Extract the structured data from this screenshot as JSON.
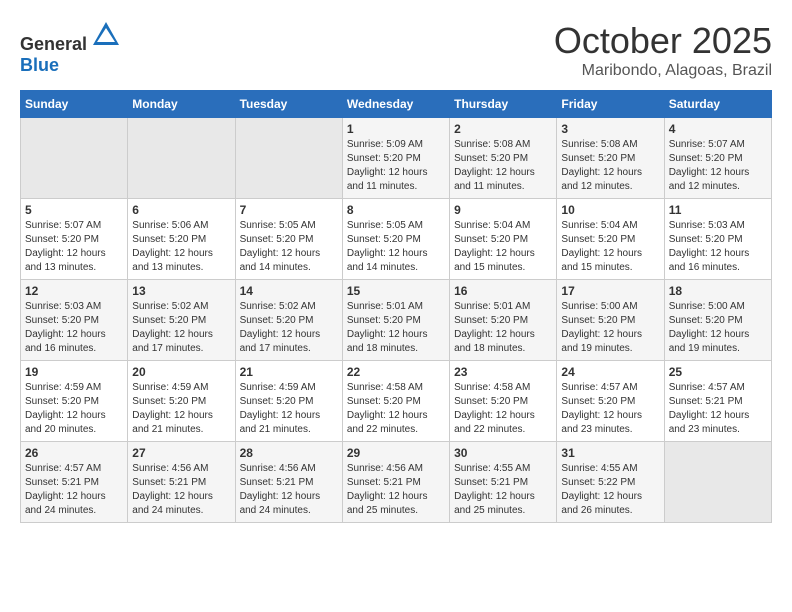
{
  "header": {
    "logo_general": "General",
    "logo_blue": "Blue",
    "month_title": "October 2025",
    "location": "Maribondo, Alagoas, Brazil"
  },
  "weekdays": [
    "Sunday",
    "Monday",
    "Tuesday",
    "Wednesday",
    "Thursday",
    "Friday",
    "Saturday"
  ],
  "weeks": [
    [
      {
        "day": "",
        "info": ""
      },
      {
        "day": "",
        "info": ""
      },
      {
        "day": "",
        "info": ""
      },
      {
        "day": "1",
        "info": "Sunrise: 5:09 AM\nSunset: 5:20 PM\nDaylight: 12 hours\nand 11 minutes."
      },
      {
        "day": "2",
        "info": "Sunrise: 5:08 AM\nSunset: 5:20 PM\nDaylight: 12 hours\nand 11 minutes."
      },
      {
        "day": "3",
        "info": "Sunrise: 5:08 AM\nSunset: 5:20 PM\nDaylight: 12 hours\nand 12 minutes."
      },
      {
        "day": "4",
        "info": "Sunrise: 5:07 AM\nSunset: 5:20 PM\nDaylight: 12 hours\nand 12 minutes."
      }
    ],
    [
      {
        "day": "5",
        "info": "Sunrise: 5:07 AM\nSunset: 5:20 PM\nDaylight: 12 hours\nand 13 minutes."
      },
      {
        "day": "6",
        "info": "Sunrise: 5:06 AM\nSunset: 5:20 PM\nDaylight: 12 hours\nand 13 minutes."
      },
      {
        "day": "7",
        "info": "Sunrise: 5:05 AM\nSunset: 5:20 PM\nDaylight: 12 hours\nand 14 minutes."
      },
      {
        "day": "8",
        "info": "Sunrise: 5:05 AM\nSunset: 5:20 PM\nDaylight: 12 hours\nand 14 minutes."
      },
      {
        "day": "9",
        "info": "Sunrise: 5:04 AM\nSunset: 5:20 PM\nDaylight: 12 hours\nand 15 minutes."
      },
      {
        "day": "10",
        "info": "Sunrise: 5:04 AM\nSunset: 5:20 PM\nDaylight: 12 hours\nand 15 minutes."
      },
      {
        "day": "11",
        "info": "Sunrise: 5:03 AM\nSunset: 5:20 PM\nDaylight: 12 hours\nand 16 minutes."
      }
    ],
    [
      {
        "day": "12",
        "info": "Sunrise: 5:03 AM\nSunset: 5:20 PM\nDaylight: 12 hours\nand 16 minutes."
      },
      {
        "day": "13",
        "info": "Sunrise: 5:02 AM\nSunset: 5:20 PM\nDaylight: 12 hours\nand 17 minutes."
      },
      {
        "day": "14",
        "info": "Sunrise: 5:02 AM\nSunset: 5:20 PM\nDaylight: 12 hours\nand 17 minutes."
      },
      {
        "day": "15",
        "info": "Sunrise: 5:01 AM\nSunset: 5:20 PM\nDaylight: 12 hours\nand 18 minutes."
      },
      {
        "day": "16",
        "info": "Sunrise: 5:01 AM\nSunset: 5:20 PM\nDaylight: 12 hours\nand 18 minutes."
      },
      {
        "day": "17",
        "info": "Sunrise: 5:00 AM\nSunset: 5:20 PM\nDaylight: 12 hours\nand 19 minutes."
      },
      {
        "day": "18",
        "info": "Sunrise: 5:00 AM\nSunset: 5:20 PM\nDaylight: 12 hours\nand 19 minutes."
      }
    ],
    [
      {
        "day": "19",
        "info": "Sunrise: 4:59 AM\nSunset: 5:20 PM\nDaylight: 12 hours\nand 20 minutes."
      },
      {
        "day": "20",
        "info": "Sunrise: 4:59 AM\nSunset: 5:20 PM\nDaylight: 12 hours\nand 21 minutes."
      },
      {
        "day": "21",
        "info": "Sunrise: 4:59 AM\nSunset: 5:20 PM\nDaylight: 12 hours\nand 21 minutes."
      },
      {
        "day": "22",
        "info": "Sunrise: 4:58 AM\nSunset: 5:20 PM\nDaylight: 12 hours\nand 22 minutes."
      },
      {
        "day": "23",
        "info": "Sunrise: 4:58 AM\nSunset: 5:20 PM\nDaylight: 12 hours\nand 22 minutes."
      },
      {
        "day": "24",
        "info": "Sunrise: 4:57 AM\nSunset: 5:20 PM\nDaylight: 12 hours\nand 23 minutes."
      },
      {
        "day": "25",
        "info": "Sunrise: 4:57 AM\nSunset: 5:21 PM\nDaylight: 12 hours\nand 23 minutes."
      }
    ],
    [
      {
        "day": "26",
        "info": "Sunrise: 4:57 AM\nSunset: 5:21 PM\nDaylight: 12 hours\nand 24 minutes."
      },
      {
        "day": "27",
        "info": "Sunrise: 4:56 AM\nSunset: 5:21 PM\nDaylight: 12 hours\nand 24 minutes."
      },
      {
        "day": "28",
        "info": "Sunrise: 4:56 AM\nSunset: 5:21 PM\nDaylight: 12 hours\nand 24 minutes."
      },
      {
        "day": "29",
        "info": "Sunrise: 4:56 AM\nSunset: 5:21 PM\nDaylight: 12 hours\nand 25 minutes."
      },
      {
        "day": "30",
        "info": "Sunrise: 4:55 AM\nSunset: 5:21 PM\nDaylight: 12 hours\nand 25 minutes."
      },
      {
        "day": "31",
        "info": "Sunrise: 4:55 AM\nSunset: 5:22 PM\nDaylight: 12 hours\nand 26 minutes."
      },
      {
        "day": "",
        "info": ""
      }
    ]
  ]
}
